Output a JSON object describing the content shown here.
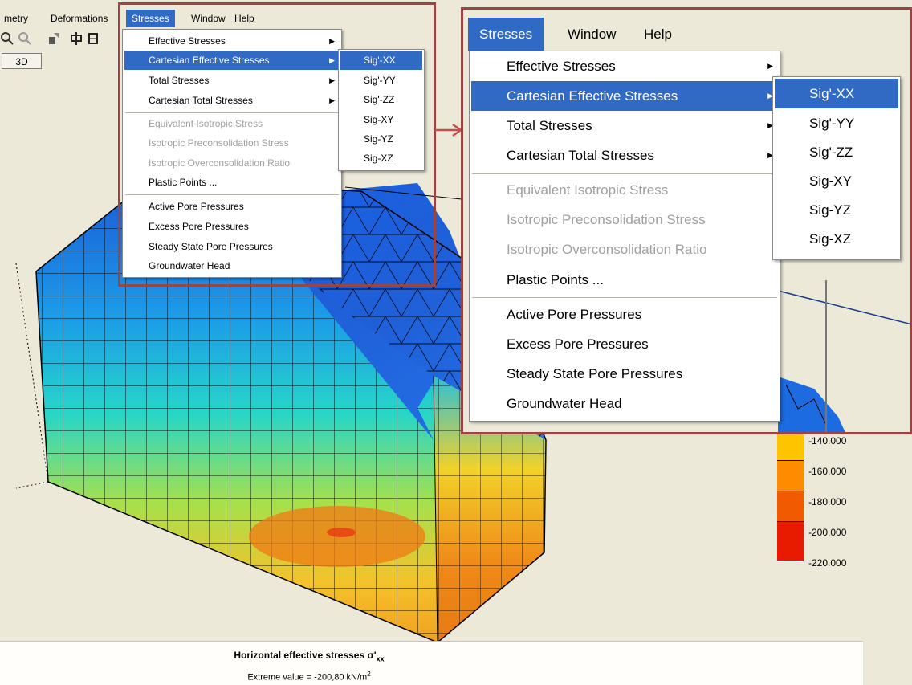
{
  "menubar": {
    "items": [
      {
        "label": "metry"
      },
      {
        "label": "Deformations"
      },
      {
        "label": "Stresses"
      },
      {
        "label": "Window"
      },
      {
        "label": "Help"
      }
    ]
  },
  "toolbar": {
    "view_3d_label": "3D"
  },
  "stresses_menu": {
    "items": [
      {
        "label": "Effective Stresses",
        "submenu": true,
        "enabled": true
      },
      {
        "label": "Cartesian Effective Stresses",
        "submenu": true,
        "enabled": true,
        "highlighted": true
      },
      {
        "label": "Total Stresses",
        "submenu": true,
        "enabled": true
      },
      {
        "label": "Cartesian Total Stresses",
        "submenu": true,
        "enabled": true
      },
      {
        "label": "Equivalent Isotropic Stress",
        "enabled": false
      },
      {
        "label": "Isotropic Preconsolidation Stress",
        "enabled": false
      },
      {
        "label": "Isotropic Overconsolidation Ratio",
        "enabled": false
      },
      {
        "label": "Plastic Points ...",
        "enabled": true
      },
      {
        "label": "Active Pore Pressures",
        "enabled": true
      },
      {
        "label": "Excess Pore Pressures",
        "enabled": true
      },
      {
        "label": "Steady State Pore Pressures",
        "enabled": true
      },
      {
        "label": "Groundwater Head",
        "enabled": true
      }
    ]
  },
  "cartesian_submenu": {
    "items": [
      {
        "label": "Sig'-XX",
        "highlighted": true
      },
      {
        "label": "Sig'-YY"
      },
      {
        "label": "Sig'-ZZ"
      },
      {
        "label": "Sig-XY"
      },
      {
        "label": "Sig-YZ"
      },
      {
        "label": "Sig-XZ"
      }
    ]
  },
  "zoom_menubar": {
    "items": [
      {
        "label": "Stresses"
      },
      {
        "label": "Window"
      },
      {
        "label": "Help"
      }
    ]
  },
  "legend": {
    "labels": [
      "-140.000",
      "-160.000",
      "-180.000",
      "-200.000",
      "-220.000"
    ],
    "colors": [
      "#ffc400",
      "#ff8c00",
      "#f25a00",
      "#e81a00",
      "#ff0000"
    ]
  },
  "caption": {
    "title": "Horizontal effective stresses σ'",
    "title_sub": "xx",
    "extreme_text": "Extreme value = -200,80 kN/m",
    "extreme_sup": "2"
  },
  "colors": {
    "menu_highlight": "#316ac5",
    "frame": "#9b4444",
    "arrow": "#c0504d"
  },
  "icons": [
    "zoom-in-icon",
    "zoom-out-icon",
    "select-icon",
    "cross-section-icon",
    "table-icon"
  ]
}
